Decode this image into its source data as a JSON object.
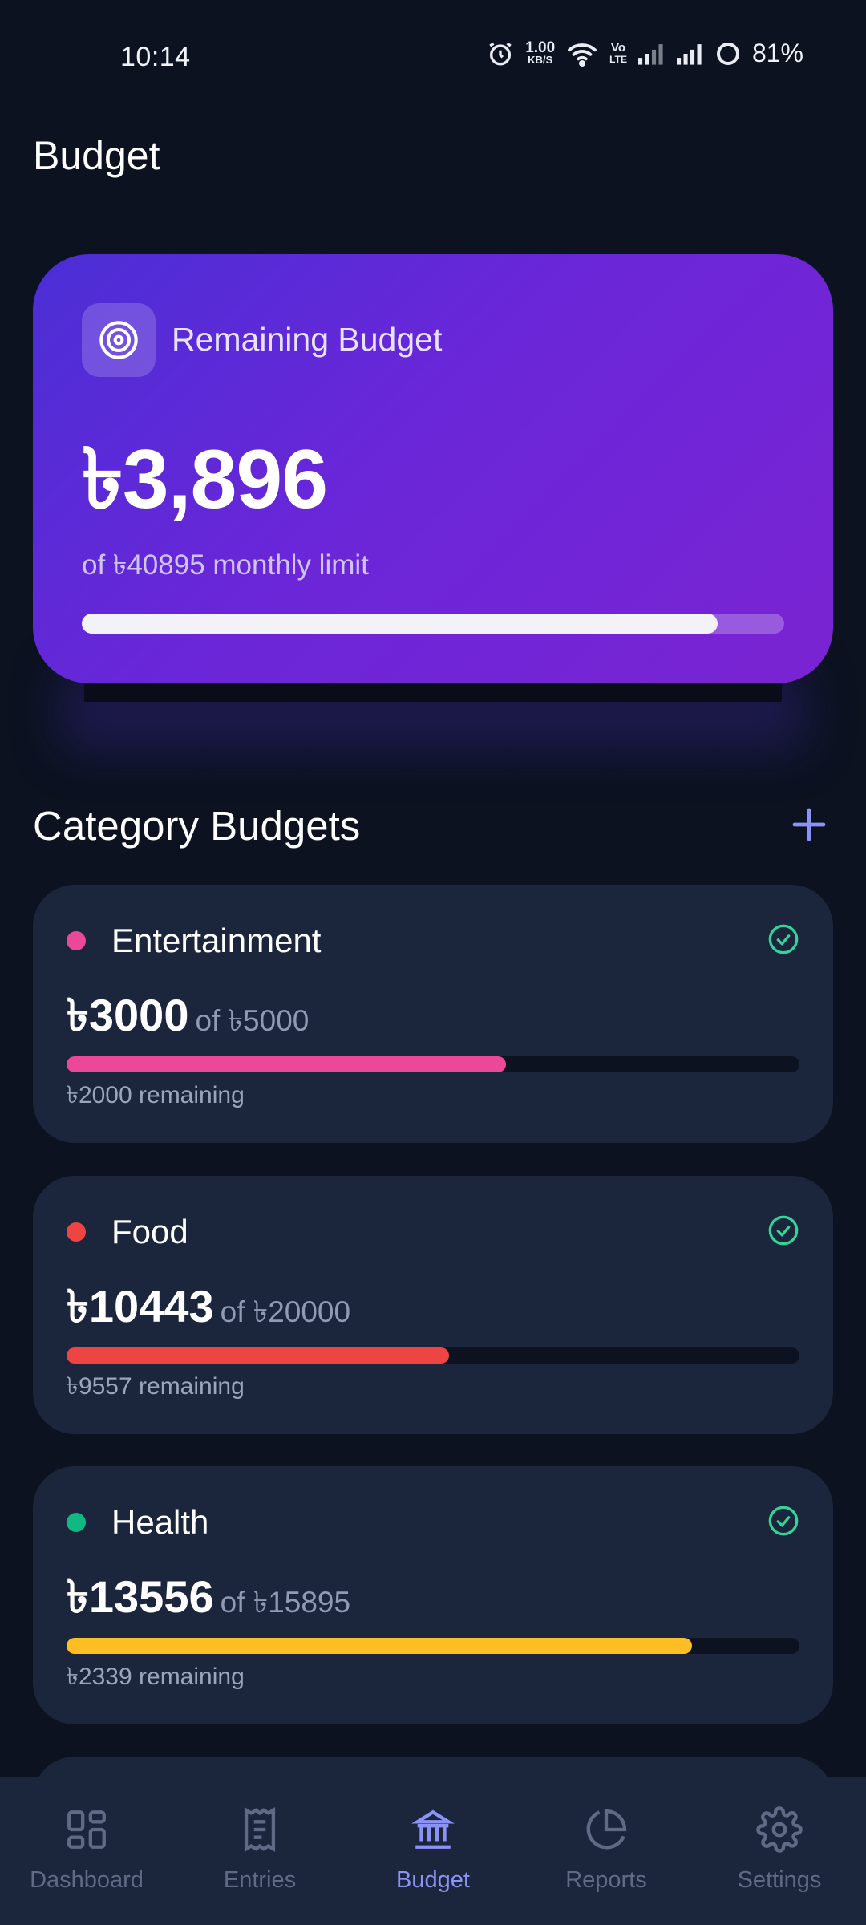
{
  "status_bar": {
    "time": "10:14",
    "net_speed_top": "1.00",
    "net_speed_bottom": "KB/S",
    "volte_top": "Vo",
    "volte_bottom": "LTE",
    "battery": "81%"
  },
  "header": {
    "title": "Budget"
  },
  "summary": {
    "label": "Remaining Budget",
    "amount": "৳3,896",
    "limit_text": "of ৳40895 monthly limit",
    "progress_fraction": 0.905,
    "gradient": [
      "#4b2fd6",
      "#7a24d2"
    ]
  },
  "categories_section": {
    "title": "Category Budgets",
    "add_icon": "plus-icon"
  },
  "categories": [
    {
      "name": "Entertainment",
      "spent": "৳3000",
      "of_limit": "of ৳5000",
      "remaining": "৳2000 remaining",
      "color": "#ec4899",
      "bar_color": "#ec4899",
      "progress_fraction": 0.6,
      "status_icon": "check-circle-icon"
    },
    {
      "name": "Food",
      "spent": "৳10443",
      "of_limit": "of ৳20000",
      "remaining": "৳9557 remaining",
      "color": "#ef4444",
      "bar_color": "#ef4444",
      "progress_fraction": 0.522,
      "status_icon": "check-circle-icon"
    },
    {
      "name": "Health",
      "spent": "৳13556",
      "of_limit": "of ৳15895",
      "remaining": "৳2339 remaining",
      "color": "#10b981",
      "bar_color": "#fbbf24",
      "progress_fraction": 0.853,
      "status_icon": "check-circle-icon"
    }
  ],
  "nav": {
    "items": [
      {
        "label": "Dashboard",
        "icon": "dashboard-grid-icon",
        "active": false
      },
      {
        "label": "Entries",
        "icon": "receipt-icon",
        "active": false
      },
      {
        "label": "Budget",
        "icon": "bank-icon",
        "active": true
      },
      {
        "label": "Reports",
        "icon": "pie-chart-icon",
        "active": false
      },
      {
        "label": "Settings",
        "icon": "gear-icon",
        "active": false
      }
    ],
    "active_color": "#8b93f8",
    "inactive_color": "#5f6b85"
  },
  "colors": {
    "background": "#0c1220",
    "card": "#1b253c",
    "check": "#34d399",
    "accent": "#8b93f8"
  }
}
